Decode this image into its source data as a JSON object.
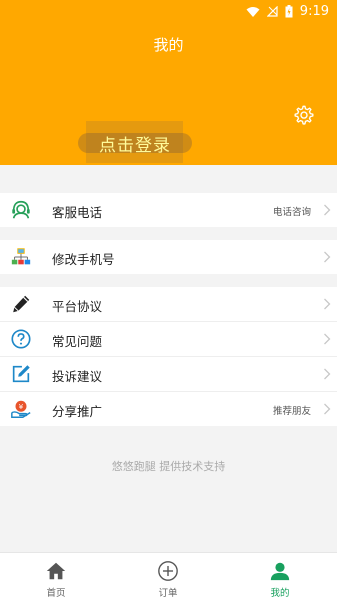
{
  "status_bar": {
    "time": "9:19"
  },
  "header": {
    "title": "我的",
    "login_label": "点击登录"
  },
  "menu_groups": [
    [
      {
        "name": "customer-service",
        "label": "客服电话",
        "value": "电话咨询",
        "icon": "headset-icon"
      }
    ],
    [
      {
        "name": "change-phone",
        "label": "修改手机号",
        "value": "",
        "icon": "network-icon"
      }
    ],
    [
      {
        "name": "platform-agreement",
        "label": "平台协议",
        "value": "",
        "icon": "pencil-icon"
      },
      {
        "name": "faq",
        "label": "常见问题",
        "value": "",
        "icon": "question-icon"
      },
      {
        "name": "feedback",
        "label": "投诉建议",
        "value": "",
        "icon": "edit-icon"
      },
      {
        "name": "share",
        "label": "分享推广",
        "value": "推荐朋友",
        "icon": "share-coin-icon"
      }
    ]
  ],
  "footer": {
    "text": "悠悠跑腿 提供技术支持"
  },
  "tabbar": {
    "tabs": [
      {
        "label": "首页",
        "icon": "home-icon",
        "active": false
      },
      {
        "label": "订单",
        "icon": "plus-circle-icon",
        "active": false
      },
      {
        "label": "我的",
        "icon": "person-icon",
        "active": true
      }
    ]
  },
  "colors": {
    "accent": "#ffa800",
    "active_tab": "#18a05e"
  }
}
